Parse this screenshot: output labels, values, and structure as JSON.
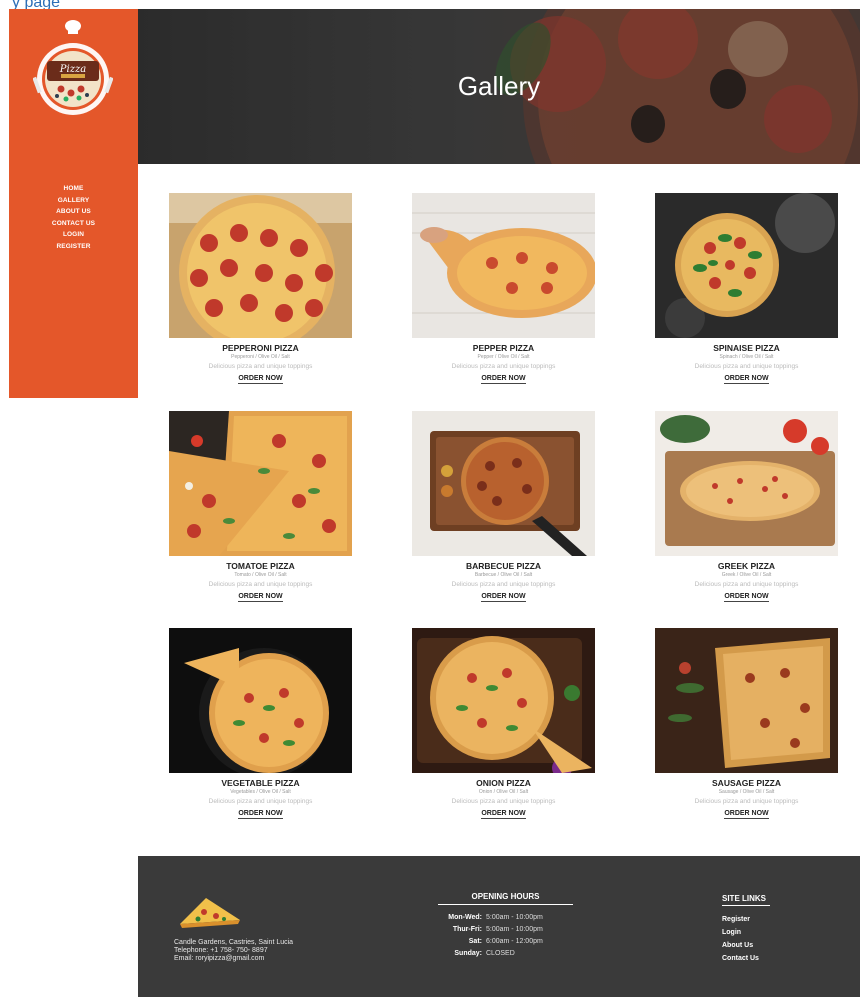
{
  "browser_strip": {
    "text": "y page"
  },
  "sidebar": {
    "logo_text": "Pizza",
    "nav": [
      {
        "label": "HOME"
      },
      {
        "label": "GALLERY"
      },
      {
        "label": "ABOUT US"
      },
      {
        "label": "CONTACT US"
      },
      {
        "label": "LOGIN"
      },
      {
        "label": "REGISTER"
      }
    ]
  },
  "hero": {
    "title": "Gallery"
  },
  "gallery": {
    "items": [
      {
        "name": "PEPPERONI PIZZA",
        "sub": "Pepperoni / Olive Oil / Salt",
        "desc": "Delicious pizza and unique toppings",
        "order": "ORDER NOW"
      },
      {
        "name": "PEPPER PIZZA",
        "sub": "Pepper / Olive Oil / Salt",
        "desc": "Delicious pizza and unique toppings",
        "order": "ORDER NOW"
      },
      {
        "name": "SPINAISE PIZZA",
        "sub": "Spinach / Olive Oil / Salt",
        "desc": "Delicious pizza and unique toppings",
        "order": "ORDER NOW"
      },
      {
        "name": "TOMATOE PIZZA",
        "sub": "Tomato / Olive Oil / Salt",
        "desc": "Delicious pizza and unique toppings",
        "order": "ORDER NOW"
      },
      {
        "name": "BARBECUE PIZZA",
        "sub": "Barbecue / Olive Oil / Salt",
        "desc": "Delicious pizza and unique toppings",
        "order": "ORDER NOW"
      },
      {
        "name": "GREEK PIZZA",
        "sub": "Greek / Olive Oil / Salt",
        "desc": "Delicious pizza and unique toppings",
        "order": "ORDER NOW"
      },
      {
        "name": "VEGETABLE PIZZA",
        "sub": "Vegetables / Olive Oil / Salt",
        "desc": "Delicious pizza and unique toppings",
        "order": "ORDER NOW"
      },
      {
        "name": "ONION PIZZA",
        "sub": "Onion / Olive Oil / Salt",
        "desc": "Delicious pizza and unique toppings",
        "order": "ORDER NOW"
      },
      {
        "name": "SAUSAGE PIZZA",
        "sub": "Sausage / Olive Oil / Salt",
        "desc": "Delicious pizza and unique toppings",
        "order": "ORDER NOW"
      }
    ]
  },
  "footer": {
    "address": "Candle Gardens, Castries, Saint Lucia",
    "telephone": "Telephone: +1 758- 750- 8897",
    "email": "Email: roryipizza@gmail.com",
    "hours_title": "OPENING HOURS",
    "hours": [
      {
        "day": "Mon-Wed:",
        "time": "5:00am - 10:00pm"
      },
      {
        "day": "Thur-Fri:",
        "time": "5:00am - 10:00pm"
      },
      {
        "day": "Sat:",
        "time": "6:00am - 12:00pm"
      },
      {
        "day": "Sunday:",
        "time": "CLOSED"
      }
    ],
    "links_title": "SITE LINKS",
    "links": [
      {
        "label": "Register"
      },
      {
        "label": "Login"
      },
      {
        "label": "About Us"
      },
      {
        "label": "Contact Us"
      }
    ]
  }
}
